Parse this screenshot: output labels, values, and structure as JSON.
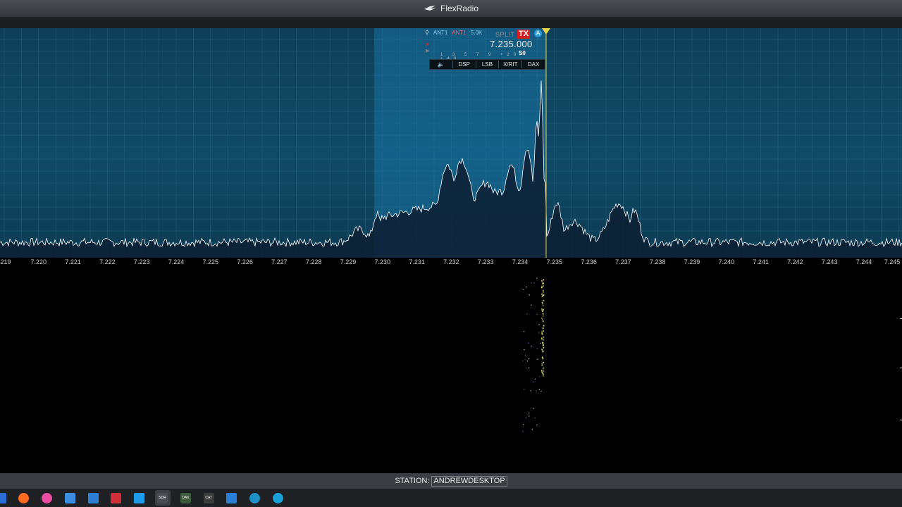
{
  "app": {
    "title": "FlexRadio",
    "logo_icon": "flexradio-wing-icon"
  },
  "slice": {
    "ant_rx": "ANT1",
    "ant_tx": "ANT1",
    "filter_width": "5.0K",
    "split_label": "SPLIT",
    "tx_label": "TX",
    "slice_letter": "A",
    "frequency": "7.235.000",
    "s_meter": "S0",
    "s_meter_scale": "1 3 5 7 9 +20 +40",
    "icons": [
      "lock-icon",
      "record-icon",
      "play-icon",
      "speaker-icon"
    ],
    "menu": [
      "DSP",
      "LSB",
      "X/RIT",
      "DAX"
    ]
  },
  "frequency_scale": {
    "unit": "MHz",
    "labels": [
      "219",
      "7.220",
      "7.221",
      "7.222",
      "7.223",
      "7.224",
      "7.225",
      "7.226",
      "7.227",
      "7.228",
      "7.229",
      "7.230",
      "7.231",
      "7.232",
      "7.233",
      "7.234",
      "7.235",
      "7.236",
      "7.237",
      "7.238",
      "7.239",
      "7.240",
      "7.241",
      "7.242",
      "7.243",
      "7.244",
      "7.245"
    ]
  },
  "spectrum": {
    "passband_start_mhz": 7.23,
    "passband_end_mhz": 7.235,
    "tuned_frequency_mhz": 7.235,
    "colors": {
      "background": "#0f4560",
      "passband": "#1a7cb2",
      "trace": "#ffffff",
      "fill": "#0e1f33",
      "tune_line": "#e8d44a"
    }
  },
  "status": {
    "station_label": "STATION:",
    "station_name": "ANDREWDESKTOP"
  },
  "taskbar": {
    "icons": [
      {
        "name": "app-partial-icon",
        "color": "#2b6fd6"
      },
      {
        "name": "firefox-icon",
        "color": "#ff6a1f"
      },
      {
        "name": "itunes-icon",
        "color": "#e84da0"
      },
      {
        "name": "calendar-icon",
        "color": "#3b8de0"
      },
      {
        "name": "photos-icon",
        "color": "#2d7fd4"
      },
      {
        "name": "news-icon",
        "color": "#d0303a"
      },
      {
        "name": "skype-icon",
        "color": "#1c9ce8"
      },
      {
        "name": "smartsdr-icon",
        "color": "#4a4d52"
      },
      {
        "name": "dax-icon",
        "color": "#3c5a3c"
      },
      {
        "name": "cat-icon",
        "color": "#3c3c3c"
      },
      {
        "name": "refresh-app-icon",
        "color": "#2b7fd6"
      },
      {
        "name": "globe-icon",
        "color": "#1e8fc7"
      },
      {
        "name": "edge-icon",
        "color": "#1aa0d8"
      }
    ],
    "active_index": 7,
    "labels": {
      "smartsdr-icon": "SDR",
      "dax-icon": "DAX",
      "cat-icon": "CAT"
    }
  }
}
